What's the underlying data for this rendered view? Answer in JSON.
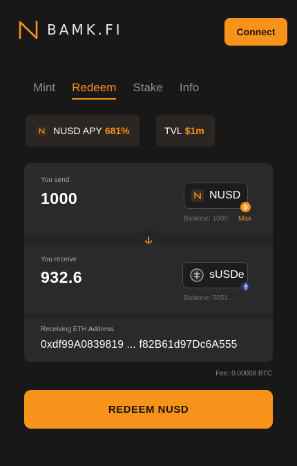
{
  "header": {
    "logo_text": "BAMK.FI",
    "connect_label": "Connect"
  },
  "tabs": [
    {
      "label": "Mint",
      "active": false
    },
    {
      "label": "Redeem",
      "active": true
    },
    {
      "label": "Stake",
      "active": false
    },
    {
      "label": "Info",
      "active": false
    }
  ],
  "stats": {
    "apy_label": "NUSD APY",
    "apy_value": "681%",
    "tvl_label": "TVL",
    "tvl_value": "$1m"
  },
  "send": {
    "label": "You send",
    "amount": "1000",
    "token": "NUSD",
    "token_icon": "nusd-icon",
    "chain_icon": "bitcoin-icon",
    "balance": "Balance: 1000",
    "max_label": "Max"
  },
  "receive": {
    "label": "You receive",
    "amount": "932.6",
    "token": "sUSDe",
    "token_icon": "susde-icon",
    "chain_icon": "ethereum-icon",
    "balance": "Balance: 5051"
  },
  "address": {
    "label": "Receiving ETH Address",
    "value": "0xdf99A0839819 ... f82B61d97Dc6A555"
  },
  "fee": "Fee: 0.00008 BTC",
  "redeem_label": "REDEEM NUSD",
  "colors": {
    "accent": "#f7931a",
    "background": "#181818",
    "card": "#242424",
    "section": "#2a2a2a"
  }
}
